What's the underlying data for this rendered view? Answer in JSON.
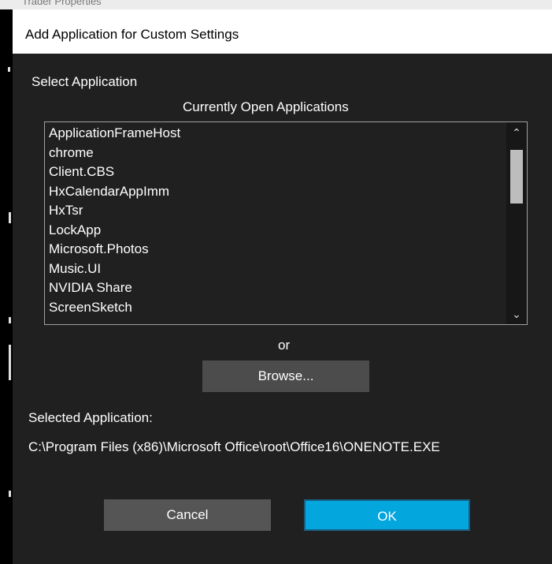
{
  "background_window": {
    "title_fragment": "Trader Properties"
  },
  "dialog": {
    "title": "Add Application for Custom Settings",
    "select_label": "Select Application",
    "list_header": "Currently Open Applications",
    "applications": [
      "ApplicationFrameHost",
      "chrome",
      "Client.CBS",
      "HxCalendarAppImm",
      "HxTsr",
      "LockApp",
      "Microsoft.Photos",
      "Music.UI",
      "NVIDIA Share",
      "ScreenSketch"
    ],
    "or_label": "or",
    "browse_label": "Browse...",
    "selected_label": "Selected Application:",
    "selected_path": "C:\\Program Files (x86)\\Microsoft Office\\root\\Office16\\ONENOTE.EXE",
    "cancel_label": "Cancel",
    "ok_label": "OK"
  },
  "icons": {
    "scroll_up": "chevron-up-icon",
    "scroll_down": "chevron-down-icon"
  },
  "colors": {
    "dialog_bg": "#202020",
    "ok_accent": "#04a6de",
    "button_bg": "#4c4c4c"
  }
}
